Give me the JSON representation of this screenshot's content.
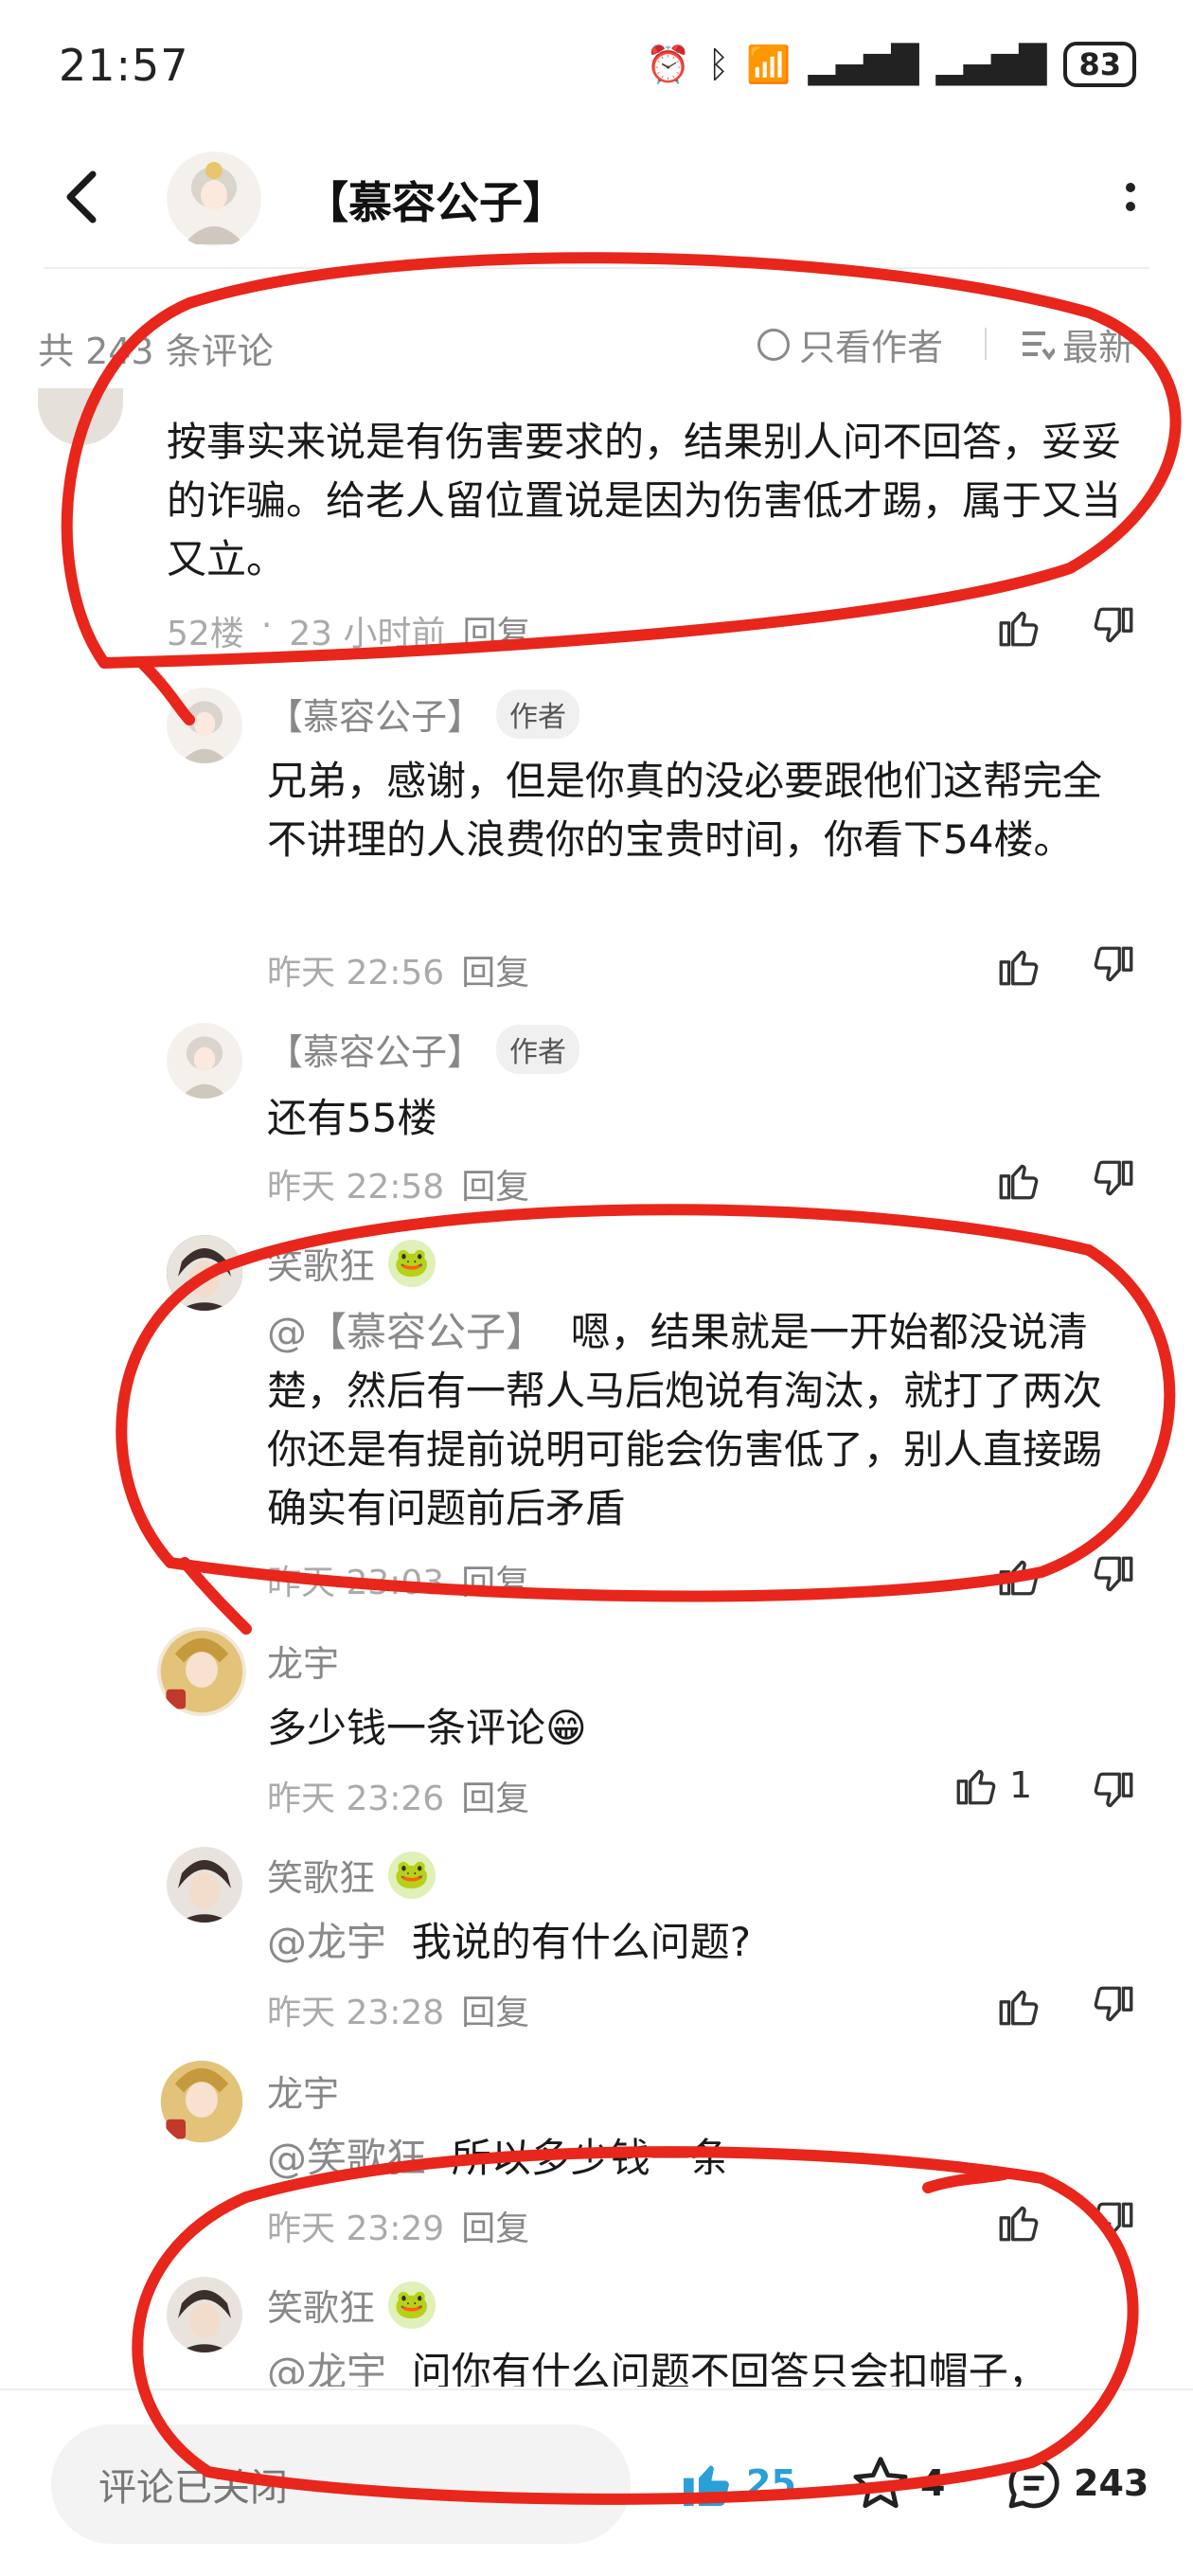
{
  "status_bar": {
    "time": "21:57",
    "battery": "83"
  },
  "header": {
    "title": "【慕容公子】"
  },
  "filter": {
    "count_label": "共 243 条评论",
    "only_author": "只看作者",
    "sort": "最新"
  },
  "comments": [
    {
      "text": "按事实来说是有伤害要求的，结果别人问不回答，妥妥的诈骗。给老人留位置说是因为伤害低才踢，属于又当又立。",
      "floor": "52楼",
      "time": "23 小时前",
      "reply": "回复"
    },
    {
      "name": "【慕容公子】",
      "tag": "作者",
      "text": "兄弟，感谢，但是你真的没必要跟他们这帮完全不讲理的人浪费你的宝贵时间，你看下54楼。",
      "time": "昨天 22:56",
      "reply": "回复"
    },
    {
      "name": "【慕容公子】",
      "tag": "作者",
      "text": "还有55楼",
      "time": "昨天 22:58",
      "reply": "回复"
    },
    {
      "name": "笑歌狂",
      "mention": "@【慕容公子】",
      "text": "嗯，结果就是一开始都没说清楚，然后有一帮人马后炮说有淘汰，就打了两次你还是有提前说明可能会伤害低了，别人直接踢确实有问题前后矛盾",
      "time": "昨天 23:03",
      "reply": "回复"
    },
    {
      "name": "龙宇",
      "text": "多少钱一条评论",
      "emoji": "😁",
      "time": "昨天 23:26",
      "reply": "回复",
      "likes": "1"
    },
    {
      "name": "笑歌狂",
      "mention": "@龙宇",
      "text": "我说的有什么问题?",
      "time": "昨天 23:28",
      "reply": "回复"
    },
    {
      "name": "龙宇",
      "mention": "@笑歌狂",
      "text": "所以多少钱一条",
      "time": "昨天 23:29",
      "reply": "回复"
    },
    {
      "name": "笑歌狂",
      "mention": "@龙宇",
      "text": "问你有什么问题不回答只会扣帽子，"
    }
  ],
  "bottom_bar": {
    "comment_placeholder": "评论已关闭",
    "likes": "25",
    "favorites": "4",
    "comments": "243"
  },
  "colors": {
    "annotation_red": "#e8261b",
    "like_blue": "#2a9fd8",
    "muted_text": "#8a8a8a"
  }
}
